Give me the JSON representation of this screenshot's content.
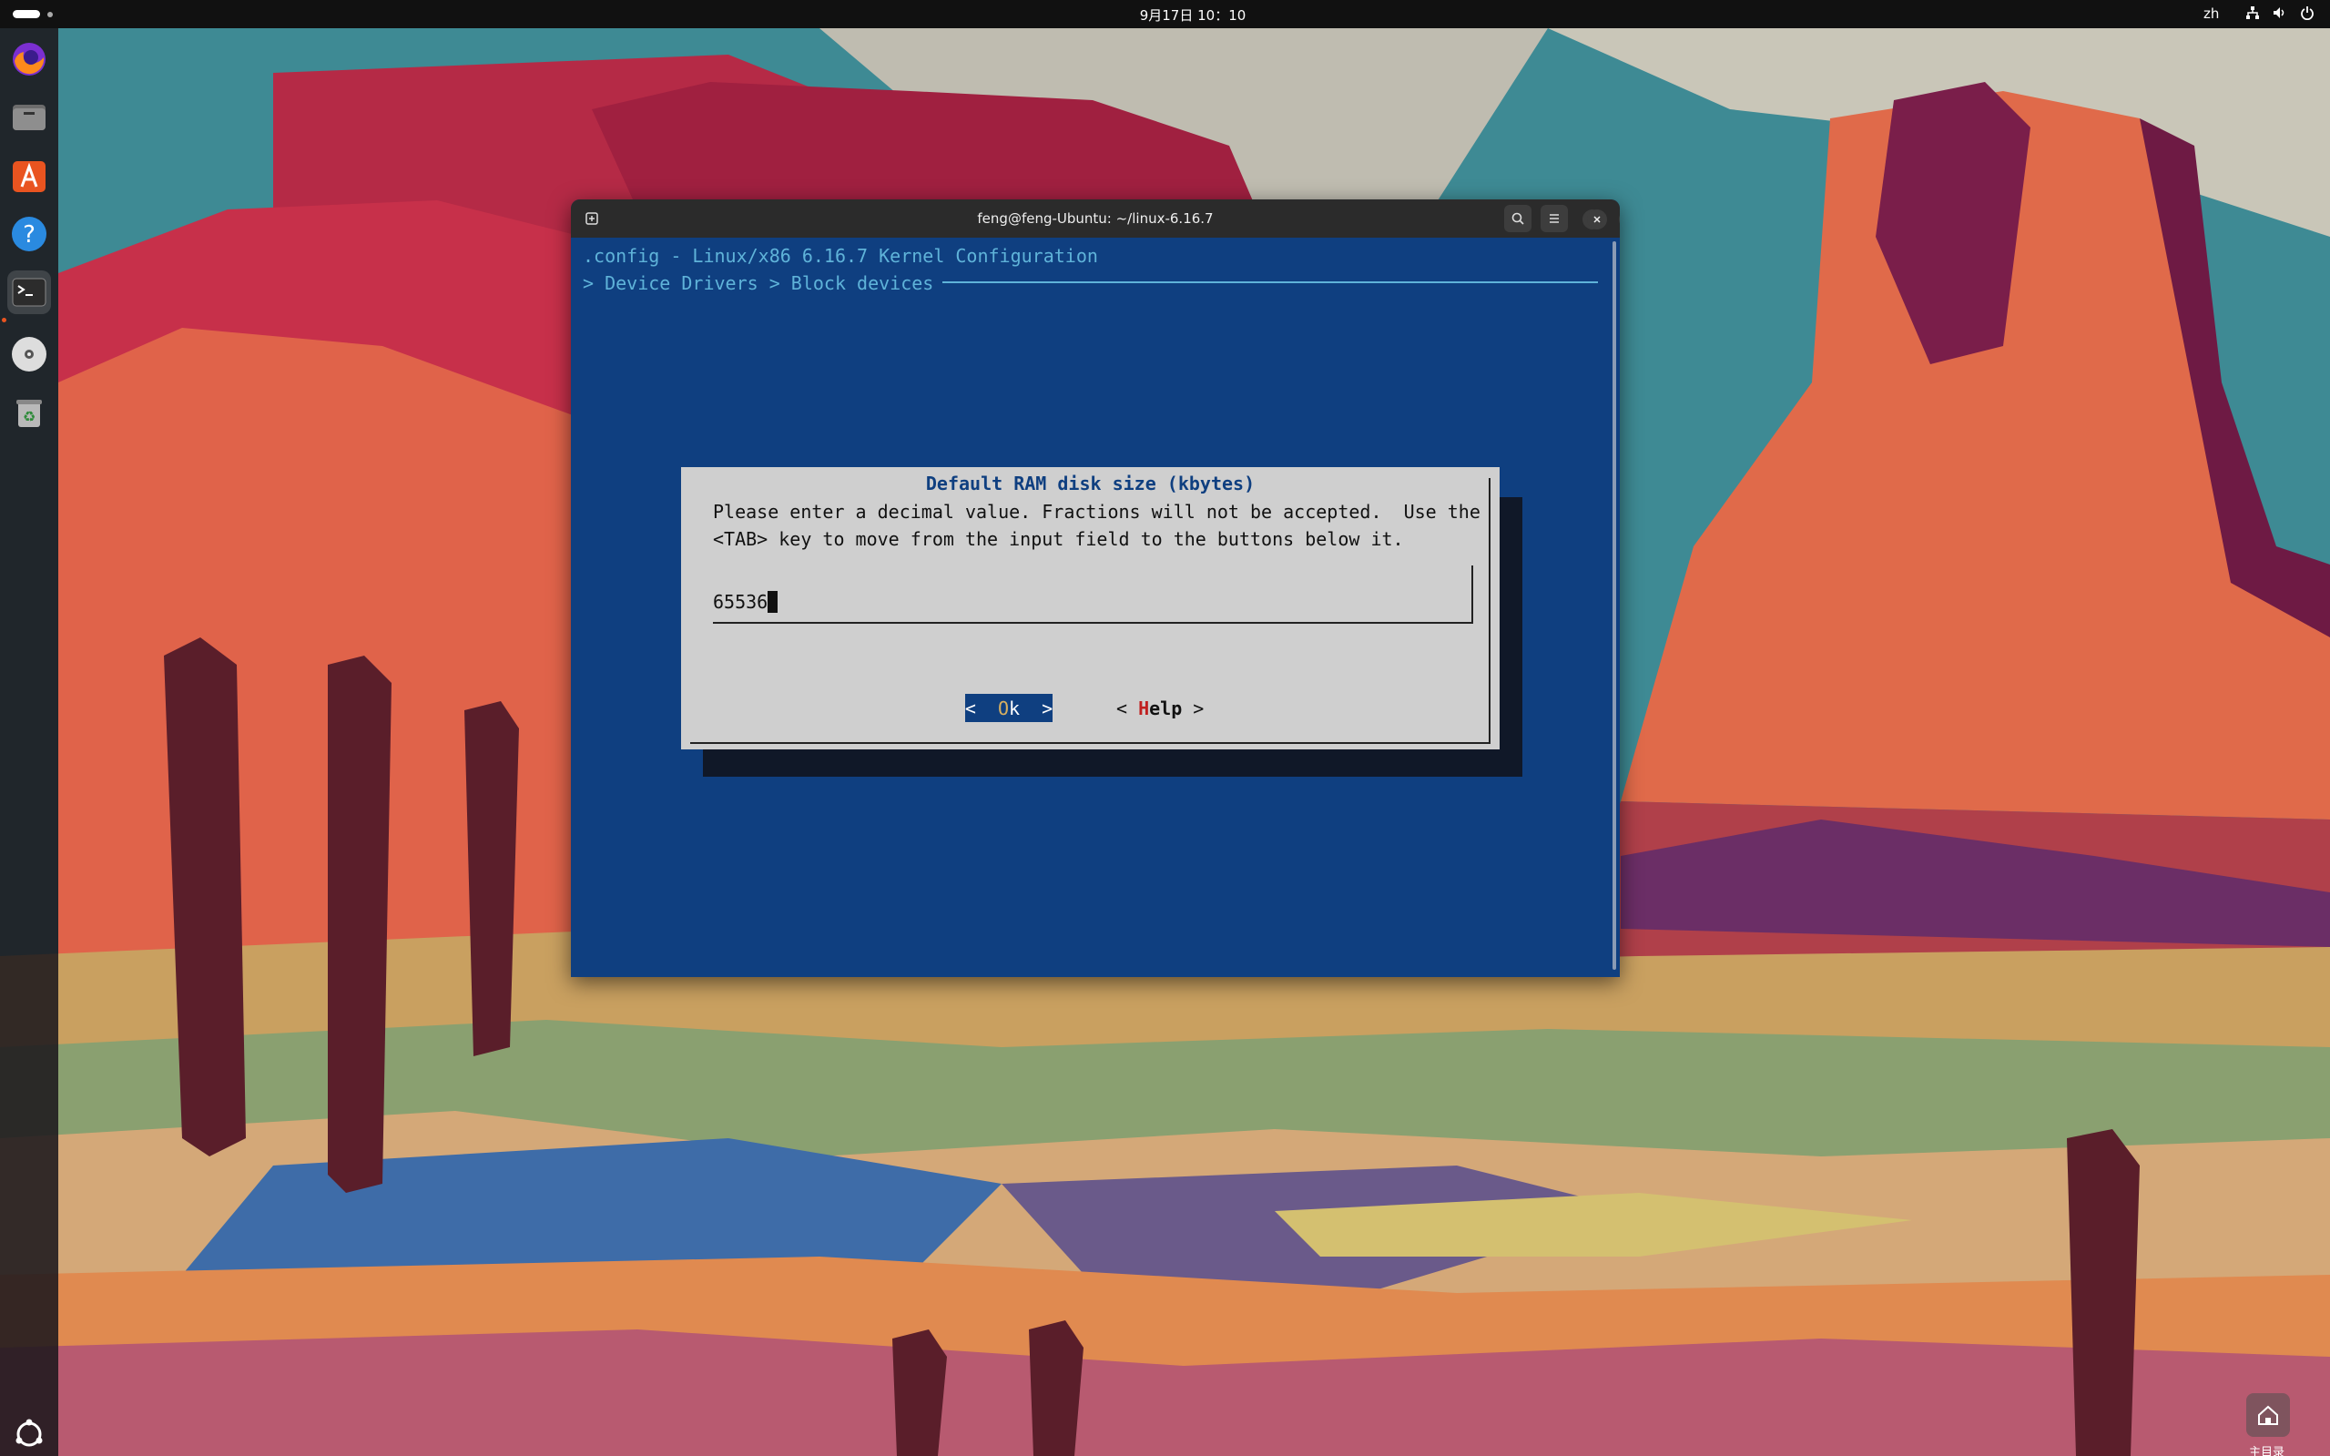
{
  "topbar": {
    "clock": "9月17日 10：10",
    "language": "zh",
    "tray_icons": [
      "network-icon",
      "volume-icon",
      "power-icon"
    ]
  },
  "dock": {
    "items": [
      {
        "name": "firefox",
        "icon": "firefox-icon"
      },
      {
        "name": "files",
        "icon": "files-icon"
      },
      {
        "name": "app-center",
        "icon": "app-center-icon"
      },
      {
        "name": "help",
        "icon": "help-icon"
      },
      {
        "name": "terminal",
        "icon": "terminal-icon",
        "active": true
      },
      {
        "name": "disc",
        "icon": "disc-icon"
      },
      {
        "name": "trash",
        "icon": "trash-icon"
      },
      {
        "name": "show-apps",
        "icon": "ubuntu-icon"
      }
    ]
  },
  "window": {
    "title": "feng@feng-Ubuntu: ~/linux-6.16.7"
  },
  "terminal": {
    "header": ".config - Linux/x86 6.16.7 Kernel Configuration",
    "breadcrumb": "> Device Drivers > Block devices"
  },
  "dialog": {
    "title": "Default RAM disk size (kbytes)",
    "line1": "Please enter a decimal value. Fractions will not be accepted.  Use the",
    "line2": "<TAB> key to move from the input field to the buttons below it.",
    "input_value": "65536",
    "ok_left": "<  ",
    "ok_hot": "O",
    "ok_rest": "k  >",
    "help_left": "< ",
    "help_hot": "H",
    "help_rest": "elp",
    "help_right": " >"
  },
  "desktop": {
    "home_label": "主目录"
  },
  "colors": {
    "terminal_bg": "#0f3f80",
    "terminal_fg": "#5fb3d9",
    "dialog_bg": "#cfcfcf",
    "accent": "#e95420"
  }
}
